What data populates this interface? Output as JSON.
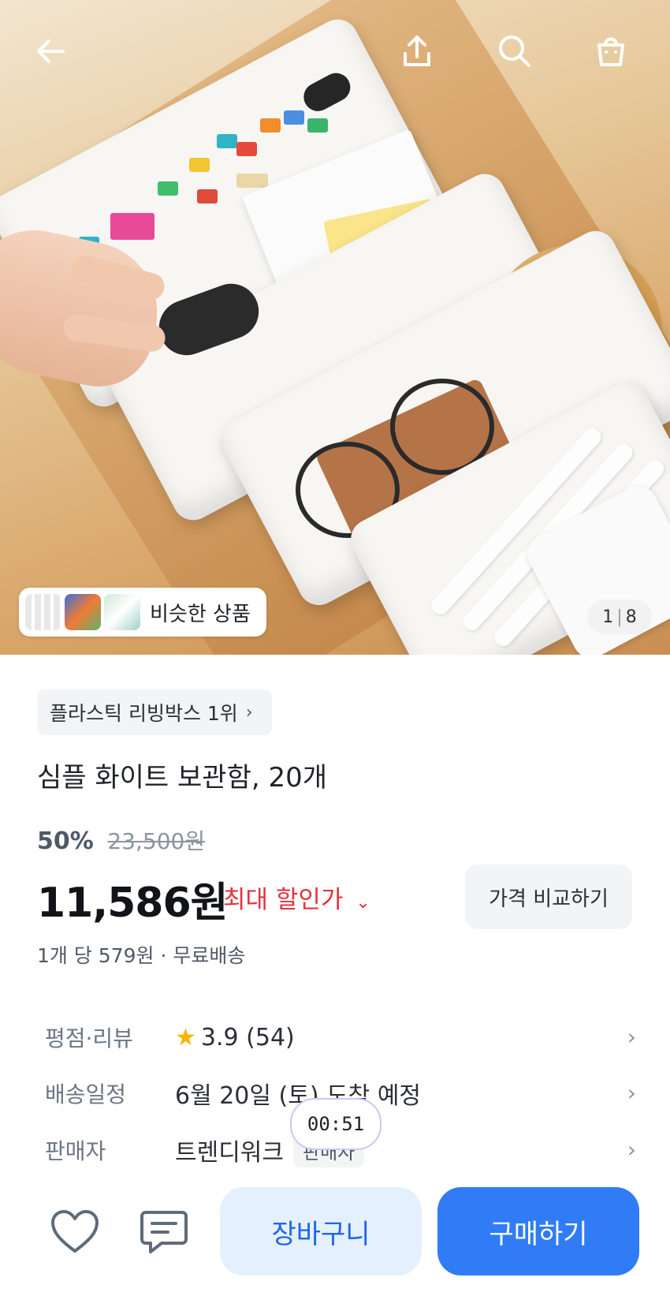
{
  "header": {
    "back_icon": "arrow-left-icon",
    "share_icon": "share-icon",
    "search_icon": "search-icon",
    "cart_icon": "shopping-bag-icon"
  },
  "gallery": {
    "similar_label": "비슷한 상품",
    "current_page": "1",
    "total_pages": "8"
  },
  "product": {
    "rank_label": "플라스틱 리빙박스 1위",
    "title": "심플 화이트 보관함, 20개",
    "discount_percent": "50%",
    "original_price": "23,500원",
    "price": "11,586원",
    "max_discount_label": "최대 할인가",
    "compare_label": "가격 비교하기",
    "unit_info": "1개 당 579원 · 무료배송"
  },
  "info_rows": {
    "rating_key": "평점·리뷰",
    "rating_value": "3.9 (54)",
    "delivery_key": "배송일정",
    "delivery_value": "6월 20일 (토) 도착 예정",
    "seller_key": "판매자",
    "seller_value": "트렌디워크",
    "seller_badge": "판매자"
  },
  "timer": "00:51",
  "bottom_bar": {
    "wishlist_icon": "heart-icon",
    "inquiry_icon": "chat-icon",
    "cart_label": "장바구니",
    "buy_label": "구매하기"
  },
  "colors": {
    "accent": "#2f7cf6",
    "discount_red": "#e5323c",
    "cart_bg": "#e5f0fd"
  }
}
